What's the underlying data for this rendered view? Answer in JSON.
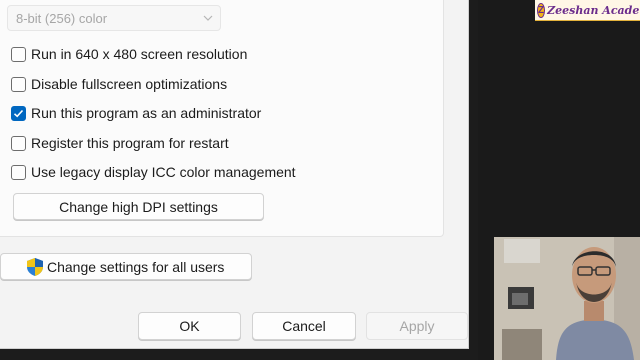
{
  "dialog": {
    "color_mode": {
      "value": "8-bit (256) color"
    },
    "options": [
      {
        "label": "Run in 640 x 480 screen resolution",
        "checked": false
      },
      {
        "label": "Disable fullscreen optimizations",
        "checked": false
      },
      {
        "label": "Run this program as an administrator",
        "checked": true
      },
      {
        "label": "Register this program for restart",
        "checked": false
      },
      {
        "label": "Use legacy display ICC color management",
        "checked": false
      }
    ],
    "dpi_button": "Change high DPI settings",
    "all_users_button": "Change settings for all users",
    "footer": {
      "ok": "OK",
      "cancel": "Cancel",
      "apply": "Apply"
    }
  },
  "overlay": {
    "logo_text": "Zeeshan Academy",
    "logo_badge": "Z"
  },
  "colors": {
    "accent": "#0067c0",
    "dialog_bg": "#f3f3f3",
    "logo_purple": "#6a2c8c"
  },
  "icons": {
    "chevron": "chevron-down-icon",
    "check": "checkmark-icon",
    "shield": "uac-shield-icon"
  }
}
